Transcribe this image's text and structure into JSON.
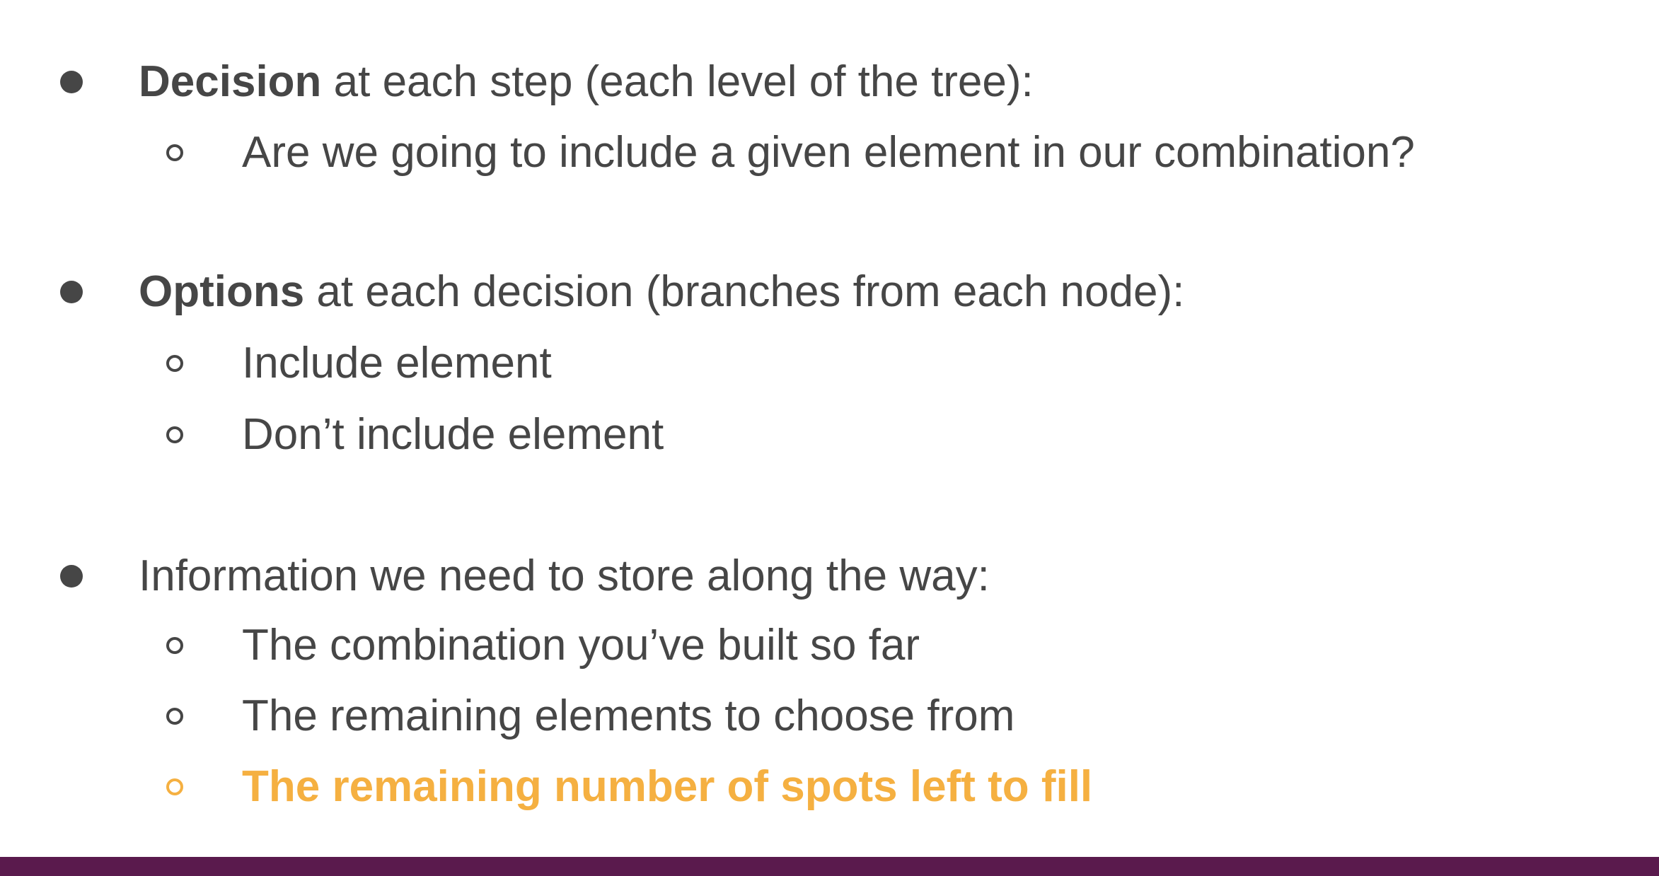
{
  "sections": [
    {
      "bold": "Decision",
      "rest": " at each step (each level of the tree):",
      "items": [
        "Are we going to include a given element in our combination?"
      ]
    },
    {
      "bold": "Options",
      "rest": " at each decision (branches from each node):",
      "items": [
        "Include element",
        "Don’t include element"
      ]
    },
    {
      "bold": "",
      "rest": "Information we need to store along the way:",
      "items": [
        "The combination you’ve built so far",
        "The remaining elements to choose from",
        "The remaining number of spots left to fill"
      ]
    }
  ],
  "colors": {
    "text": "#464646",
    "highlight": "#f5b041",
    "bottom_bar": "#5a1a4d"
  }
}
